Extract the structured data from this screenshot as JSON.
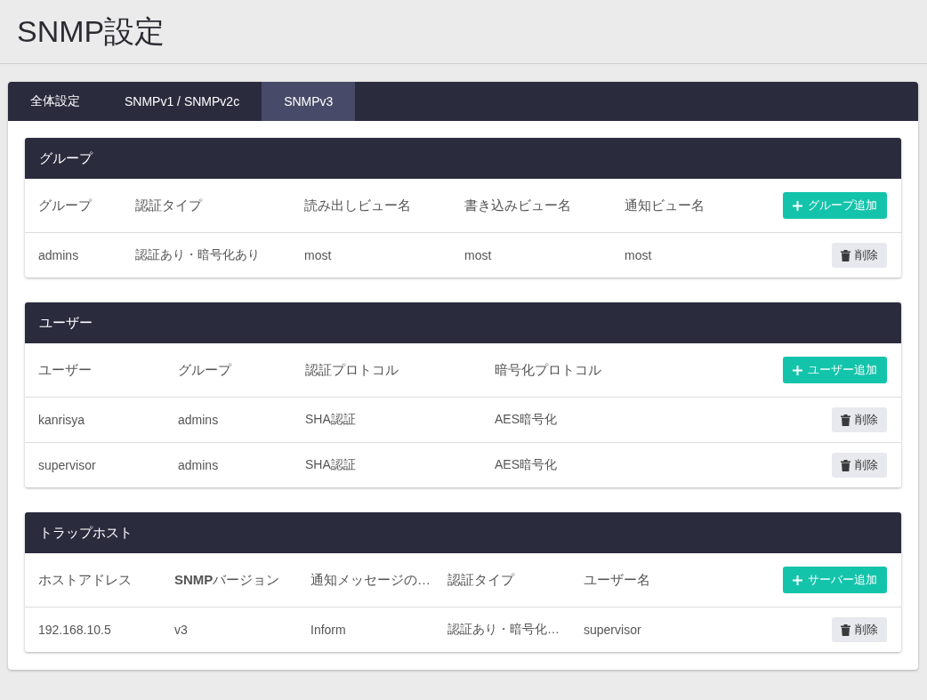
{
  "page_title": "SNMP設定",
  "tabs": [
    {
      "label": "全体設定",
      "selected": false
    },
    {
      "label": "SNMPv1 / SNMPv2c",
      "selected": false
    },
    {
      "label": "SNMPv3",
      "selected": true
    }
  ],
  "sections": [
    {
      "title": "グループ",
      "columns": [
        "グループ",
        "認証タイプ",
        "読み出しビュー名",
        "書き込みビュー名",
        "通知ビュー名"
      ],
      "add_button": "グループ追加",
      "rows": [
        {
          "cells": [
            "admins",
            "認証あり・暗号化あり",
            "most",
            "most",
            "most"
          ],
          "delete_button": "削除"
        }
      ]
    },
    {
      "title": "ユーザー",
      "columns": [
        "ユーザー",
        "グループ",
        "認証プロトコル",
        "暗号化プロトコル"
      ],
      "add_button": "ユーザー追加",
      "rows": [
        {
          "cells": [
            "kanrisya",
            "admins",
            "SHA認証",
            "AES暗号化"
          ],
          "delete_button": "削除"
        },
        {
          "cells": [
            "supervisor",
            "admins",
            "SHA認証",
            "AES暗号化"
          ],
          "delete_button": "削除"
        }
      ]
    },
    {
      "title": "トラップホスト",
      "columns": [
        "ホストアドレス",
        "**SNMP**バージョン",
        "通知メッセージの…",
        "認証タイプ",
        "ユーザー名"
      ],
      "add_button": "サーバー追加",
      "rows": [
        {
          "cells": [
            "192.168.10.5",
            "v3",
            "Inform",
            "認証あり・暗号化…",
            "supervisor"
          ],
          "delete_button": "削除"
        }
      ]
    }
  ]
}
